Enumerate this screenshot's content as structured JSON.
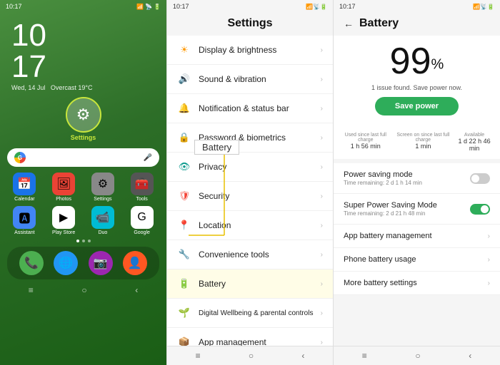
{
  "panel1": {
    "status_bar": {
      "time": "10:17"
    },
    "clock": {
      "time": "10\n17",
      "time_h": "10",
      "time_m": "17",
      "date": "Wed, 14 Jul",
      "weather": "Overcast 19°C"
    },
    "settings_icon": {
      "label": "Settings"
    },
    "search_bar": {
      "placeholder": ""
    },
    "apps_row1": [
      {
        "label": "Calendar",
        "bg": "#1a73e8",
        "icon": "📅"
      },
      {
        "label": "Photos",
        "bg": "#ea4335",
        "icon": "🖼"
      },
      {
        "label": "Settings",
        "bg": "#888",
        "icon": "⚙️"
      },
      {
        "label": "Tools",
        "bg": "#555",
        "icon": "🧰"
      }
    ],
    "apps_row2": [
      {
        "label": "Assistant",
        "bg": "#4285f4",
        "icon": "🅰"
      },
      {
        "label": "Play Store",
        "bg": "#fff",
        "icon": "▶"
      },
      {
        "label": "Duo",
        "bg": "#00bcd4",
        "icon": "📹"
      },
      {
        "label": "Google",
        "bg": "#fff",
        "icon": "G"
      }
    ],
    "dock": [
      {
        "label": "Phone",
        "bg": "#4caf50",
        "icon": "📞"
      },
      {
        "label": "Browser",
        "bg": "#2196f3",
        "icon": "🌐"
      },
      {
        "label": "Camera",
        "bg": "#9c27b0",
        "icon": "📷"
      },
      {
        "label": "Contacts",
        "bg": "#ff5722",
        "icon": "👤"
      }
    ],
    "nav": [
      "≡",
      "○",
      "‹"
    ]
  },
  "panel2": {
    "status_bar": {
      "time": "10:17"
    },
    "header": "Settings",
    "items": [
      {
        "icon": "☀",
        "label": "Display & brightness",
        "color": "#ff9800"
      },
      {
        "icon": "🔊",
        "label": "Sound & vibration",
        "color": "#607d8b"
      },
      {
        "icon": "🔔",
        "label": "Notification & status bar",
        "color": "#9c27b0"
      },
      {
        "icon": "🔒",
        "label": "Password & biometrics",
        "color": "#3f51b5"
      },
      {
        "icon": "👁",
        "label": "Privacy",
        "color": "#009688"
      },
      {
        "icon": "🛡",
        "label": "Security",
        "color": "#f44336"
      },
      {
        "icon": "📍",
        "label": "Location",
        "color": "#e91e63"
      },
      {
        "icon": "🔧",
        "label": "Convenience tools",
        "color": "#ff5722"
      },
      {
        "icon": "🔋",
        "label": "Battery",
        "color": "#4caf50"
      },
      {
        "icon": "🌱",
        "label": "Digital Wellbeing & parental controls",
        "color": "#8bc34a"
      },
      {
        "icon": "📦",
        "label": "App management",
        "color": "#795548"
      }
    ],
    "battery_annotation": "Battery",
    "nav": [
      "≡",
      "○",
      "‹"
    ]
  },
  "panel3": {
    "status_bar": {
      "time": "10:17"
    },
    "title": "Battery",
    "percent": "99",
    "percent_sym": "%",
    "issue_text": "1 issue found. Save power now.",
    "save_btn": "Save power",
    "stats": [
      {
        "label": "Used since last full charge",
        "value": "1 h 56 min"
      },
      {
        "label": "Screen on since last full charge",
        "value": "1 min"
      },
      {
        "label": "Available",
        "value": "1 d 22 h 46 min"
      }
    ],
    "menu_items": [
      {
        "title": "Power saving mode",
        "sub": "Time remaining: 2 d 1 h 14 min",
        "toggle": "off"
      },
      {
        "title": "Super Power Saving Mode",
        "sub": "Time remaining: 2 d 21 h 48 min",
        "toggle": "on"
      },
      {
        "title": "App battery management",
        "sub": "",
        "chevron": true
      },
      {
        "title": "Phone battery usage",
        "sub": "",
        "chevron": true
      },
      {
        "title": "More battery settings",
        "sub": "",
        "chevron": true
      }
    ],
    "nav": [
      "≡",
      "○",
      "‹"
    ]
  }
}
